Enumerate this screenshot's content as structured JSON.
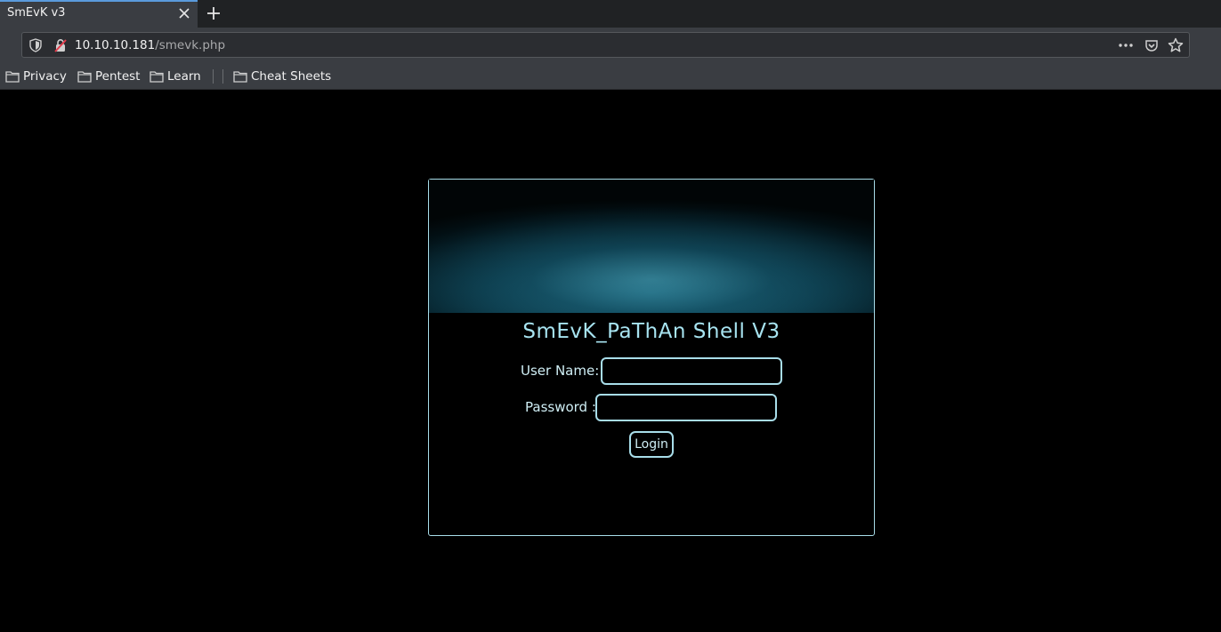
{
  "browser": {
    "tab_title": "SmEvK v3",
    "url_host": "10.10.10.181",
    "url_path": "/smevk.php",
    "bookmarks": [
      "Privacy",
      "Pentest",
      "Learn",
      "Cheat Sheets"
    ]
  },
  "login": {
    "title": "SmEvK_PaThAn Shell V3",
    "username_label": "User Name:",
    "username_value": "",
    "password_label": "Password :",
    "password_value": "",
    "button_label": "Login"
  },
  "colors": {
    "accent": "#a8dde9",
    "title": "#a7e3f0",
    "background": "#000000"
  },
  "icons": [
    "close-icon",
    "plus-icon",
    "shield-icon",
    "insecure-lock-icon",
    "more-icon",
    "pocket-icon",
    "star-icon",
    "folder-icon"
  ]
}
